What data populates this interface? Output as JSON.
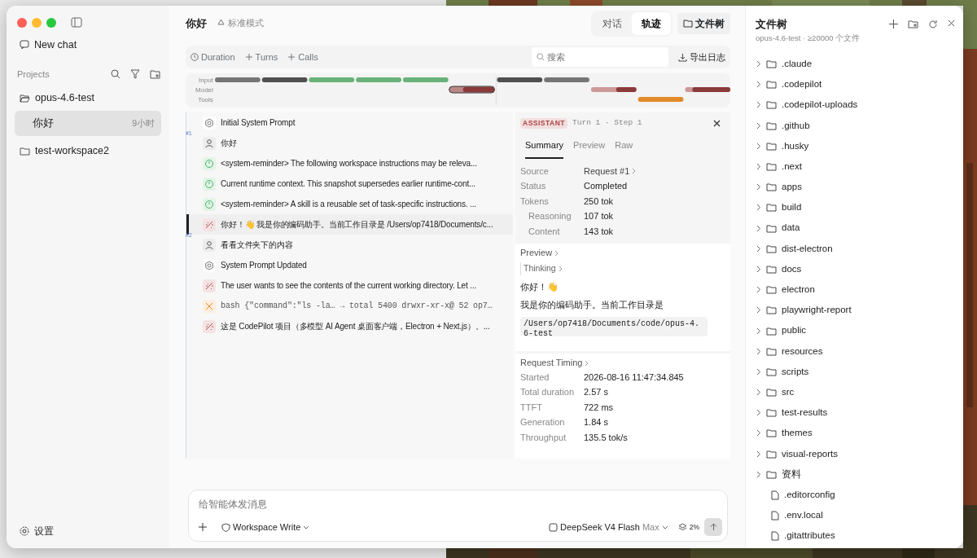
{
  "sidebar": {
    "new_chat": "New chat",
    "projects_label": "Projects",
    "projects": [
      {
        "name": "opus-4.6-test",
        "kind": "open",
        "chats": [
          {
            "title": "你好",
            "time": "9小时",
            "selected": true
          }
        ]
      },
      {
        "name": "test-workspace2",
        "kind": "closed"
      }
    ],
    "settings": "设置"
  },
  "header": {
    "title": "你好",
    "mode": "标准模式",
    "view_tabs": [
      {
        "label": "对话",
        "selected": false
      },
      {
        "label": "轨迹",
        "selected": true
      }
    ],
    "file_tree_button": "文件树"
  },
  "toolbar": {
    "filters": [
      "Duration",
      "Turns",
      "Calls"
    ],
    "search": {
      "placeholder": "搜索"
    },
    "export": "导出日志"
  },
  "timeline": {
    "lanes": [
      "Input",
      "Model",
      "Tools"
    ]
  },
  "trace": [
    {
      "kind": "system",
      "text": "Initial System Prompt",
      "selected": false
    },
    {
      "kind": "user",
      "text": "你好",
      "selected": false,
      "turn": "#1"
    },
    {
      "kind": "reminder",
      "text": "<system-reminder> The following workspace instructions may be releva...",
      "selected": false
    },
    {
      "kind": "reminder",
      "text": "Current runtime context. This snapshot supersedes earlier runtime-cont...",
      "selected": false
    },
    {
      "kind": "reminder",
      "text": "<system-reminder> A skill is a reusable set of task-specific instructions. ...",
      "selected": false
    },
    {
      "kind": "assistant",
      "text": "你好！👋 我是你的编码助手。当前工作目录是 /Users/op7418/Documents/c...",
      "selected": true
    },
    {
      "kind": "user",
      "text": "看看文件夹下的内容",
      "selected": false,
      "turn": "#2"
    },
    {
      "kind": "system",
      "text": "System Prompt Updated",
      "selected": false
    },
    {
      "kind": "assistant",
      "text": "The user wants to see the contents of the current working directory. Let ...",
      "selected": false
    },
    {
      "kind": "tool",
      "text": "bash {\"command\":\"ls -la…  → total 5400 drwxr-xr-x@ 52 op7…",
      "selected": false
    },
    {
      "kind": "assistant",
      "text": "这是 CodePilot 项目（多模型 AI Agent 桌面客户端，Electron + Next.js）。...",
      "selected": false
    }
  ],
  "detail": {
    "role": "ASSISTANT",
    "step": "Turn 1 · Step 1",
    "tabs": [
      {
        "label": "Summary",
        "selected": true
      },
      {
        "label": "Preview",
        "selected": false
      },
      {
        "label": "Raw",
        "selected": false
      }
    ],
    "summary": [
      {
        "label": "Source",
        "value": "Request #1",
        "link": true,
        "sub": false
      },
      {
        "label": "Status",
        "value": "Completed",
        "link": false,
        "sub": false
      },
      {
        "label": "Tokens",
        "value": "250 tok",
        "link": false,
        "sub": false
      },
      {
        "label": "Reasoning",
        "value": "107 tok",
        "link": false,
        "sub": true
      },
      {
        "label": "Content",
        "value": "143 tok",
        "link": false,
        "sub": true
      }
    ],
    "preview": {
      "title": "Preview",
      "thinking": "Thinking",
      "paragraphs": [
        "你好！👋",
        "我是你的编码助手。当前工作目录是"
      ],
      "code": "/Users/op7418/Documents/code/opus-4.6-test"
    },
    "timing": {
      "title": "Request Timing",
      "rows": [
        {
          "label": "Started",
          "value": "2026-08-16 11:47:34.845"
        },
        {
          "label": "Total duration",
          "value": "2.57 s"
        },
        {
          "label": "TTFT",
          "value": "722 ms"
        },
        {
          "label": "Generation",
          "value": "1.84 s"
        },
        {
          "label": "Throughput",
          "value": "135.5 tok/s"
        }
      ]
    }
  },
  "composer": {
    "placeholder": "给智能体发消息",
    "permission": "Workspace Write",
    "model": "DeepSeek V4 Flash",
    "effort": "Max",
    "context": "2%"
  },
  "file_tree": {
    "title": "文件树",
    "subtitle": "opus-4.6-test · ≥20000 个文件",
    "items": [
      {
        "kind": "folder",
        "name": ".claude"
      },
      {
        "kind": "folder",
        "name": ".codepilot"
      },
      {
        "kind": "folder",
        "name": ".codepilot-uploads"
      },
      {
        "kind": "folder",
        "name": ".github"
      },
      {
        "kind": "folder",
        "name": ".husky"
      },
      {
        "kind": "folder",
        "name": ".next"
      },
      {
        "kind": "folder",
        "name": "apps"
      },
      {
        "kind": "folder",
        "name": "build"
      },
      {
        "kind": "folder",
        "name": "data"
      },
      {
        "kind": "folder",
        "name": "dist-electron"
      },
      {
        "kind": "folder",
        "name": "docs"
      },
      {
        "kind": "folder",
        "name": "electron"
      },
      {
        "kind": "folder",
        "name": "playwright-report"
      },
      {
        "kind": "folder",
        "name": "public"
      },
      {
        "kind": "folder",
        "name": "resources"
      },
      {
        "kind": "folder",
        "name": "scripts"
      },
      {
        "kind": "folder",
        "name": "src"
      },
      {
        "kind": "folder",
        "name": "test-results"
      },
      {
        "kind": "folder",
        "name": "themes"
      },
      {
        "kind": "folder",
        "name": "visual-reports"
      },
      {
        "kind": "folder",
        "name": "资料"
      },
      {
        "kind": "file",
        "name": ".editorconfig"
      },
      {
        "kind": "file",
        "name": ".env.local"
      },
      {
        "kind": "file",
        "name": ".gitattributes"
      }
    ]
  }
}
